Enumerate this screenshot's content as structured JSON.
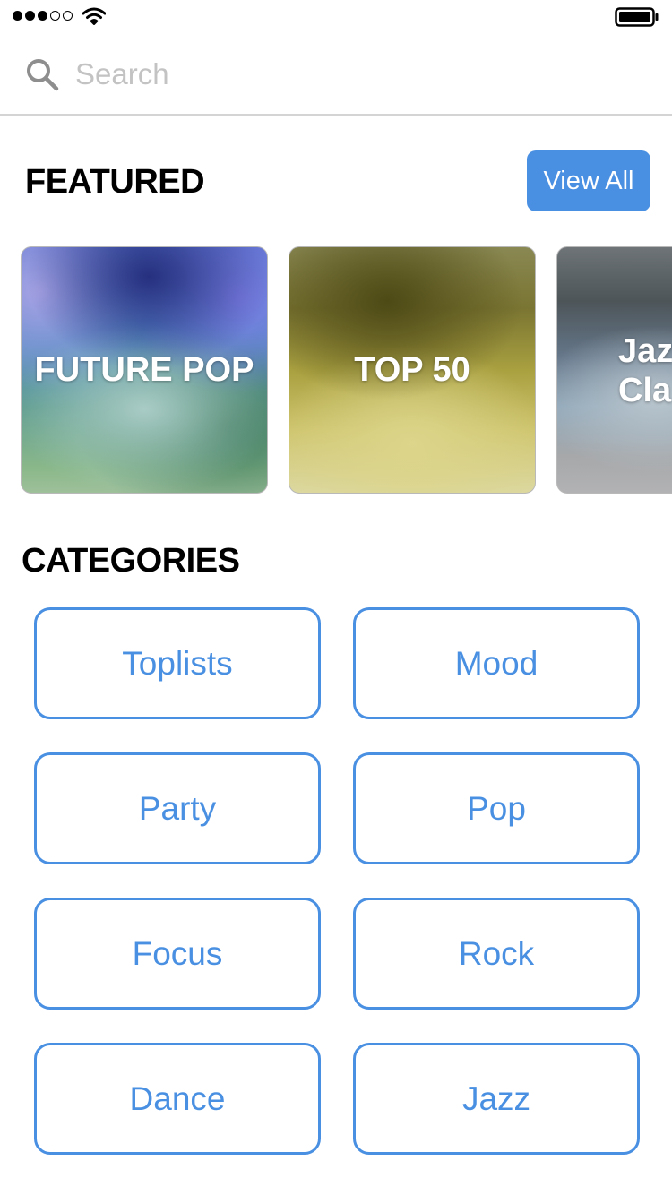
{
  "status_bar": {
    "signal_bars": 5,
    "signal_filled": 3
  },
  "search": {
    "placeholder": "Search",
    "value": ""
  },
  "featured": {
    "title": "FEATURED",
    "view_all_label": "View All",
    "tiles": [
      {
        "label": "FUTURE POP"
      },
      {
        "label": "TOP 50"
      },
      {
        "label": "Jazz\nClassics",
        "label_visible": "Jaz\nCla"
      }
    ]
  },
  "categories": {
    "title": "CATEGORIES",
    "items": [
      {
        "label": "Toplists"
      },
      {
        "label": "Mood"
      },
      {
        "label": "Party"
      },
      {
        "label": "Pop"
      },
      {
        "label": "Focus"
      },
      {
        "label": "Rock"
      },
      {
        "label": "Dance"
      },
      {
        "label": "Jazz"
      }
    ]
  },
  "colors": {
    "accent": "#4a90e2",
    "divider": "#d4d4d4",
    "placeholder": "#c3c3c3"
  }
}
